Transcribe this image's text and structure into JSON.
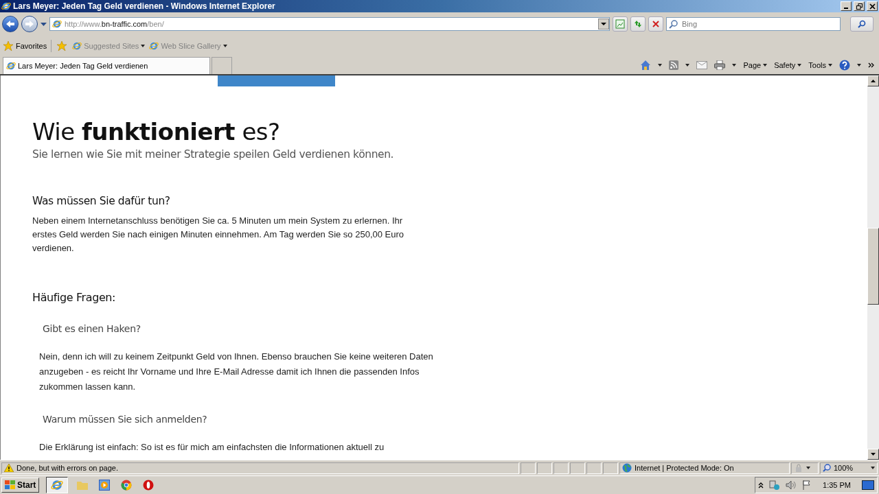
{
  "window": {
    "title": "Lars Meyer: Jeden Tag Geld verdienen - Windows Internet Explorer"
  },
  "address_bar": {
    "prefix": "http://www.",
    "domain": "bn-traffic.com",
    "path": "/ben/"
  },
  "search": {
    "placeholder": "Bing"
  },
  "favorites_bar": {
    "favorites": "Favorites",
    "links": [
      "Suggested Sites",
      "Web Slice Gallery"
    ]
  },
  "tabs": [
    {
      "label": "Lars Meyer: Jeden Tag Geld verdienen",
      "selected": true
    }
  ],
  "command_bar": [
    "Page",
    "Safety",
    "Tools"
  ],
  "page": {
    "heading": "Wie **funktioniert** es?",
    "subheading": "Sie lernen wie Sie mit meiner Strategie speilen Geld verdienen können.",
    "sections": [
      {
        "kind": "info",
        "title": "Was müssen Sie dafür tun?",
        "text": "Neben einem Internetanschluss benötigen Sie ca. 5 Minuten um mein System zu erlernen. Ihr erstes Geld werden Sie nach einigen Minuten einnehmen. Am Tag werden Sie so 250,00 Euro verdienen."
      },
      {
        "kind": "heading",
        "title": "Häufige Fragen:"
      },
      {
        "kind": "faq",
        "title": "Gibt es einen Haken?",
        "text": "Nein, denn ich will zu keinem Zeitpunkt Geld von Ihnen. Ebenso brauchen Sie keine weiteren Daten anzugeben - es reicht Ihr Vorname und Ihre E-Mail Adresse damit ich Ihnen die passenden Infos zukommen lassen kann."
      },
      {
        "kind": "faq",
        "title": "Warum müssen Sie sich anmelden?",
        "text": "Die Erklärung ist einfach: So ist es für mich am einfachsten die Informationen aktuell zu"
      }
    ]
  },
  "status_bar": {
    "message": "Done, but with errors on page.",
    "zone": "Internet | Protected Mode: On",
    "zoom": "100%"
  },
  "taskbar": {
    "start": "Start",
    "clock": "1:35 PM"
  }
}
